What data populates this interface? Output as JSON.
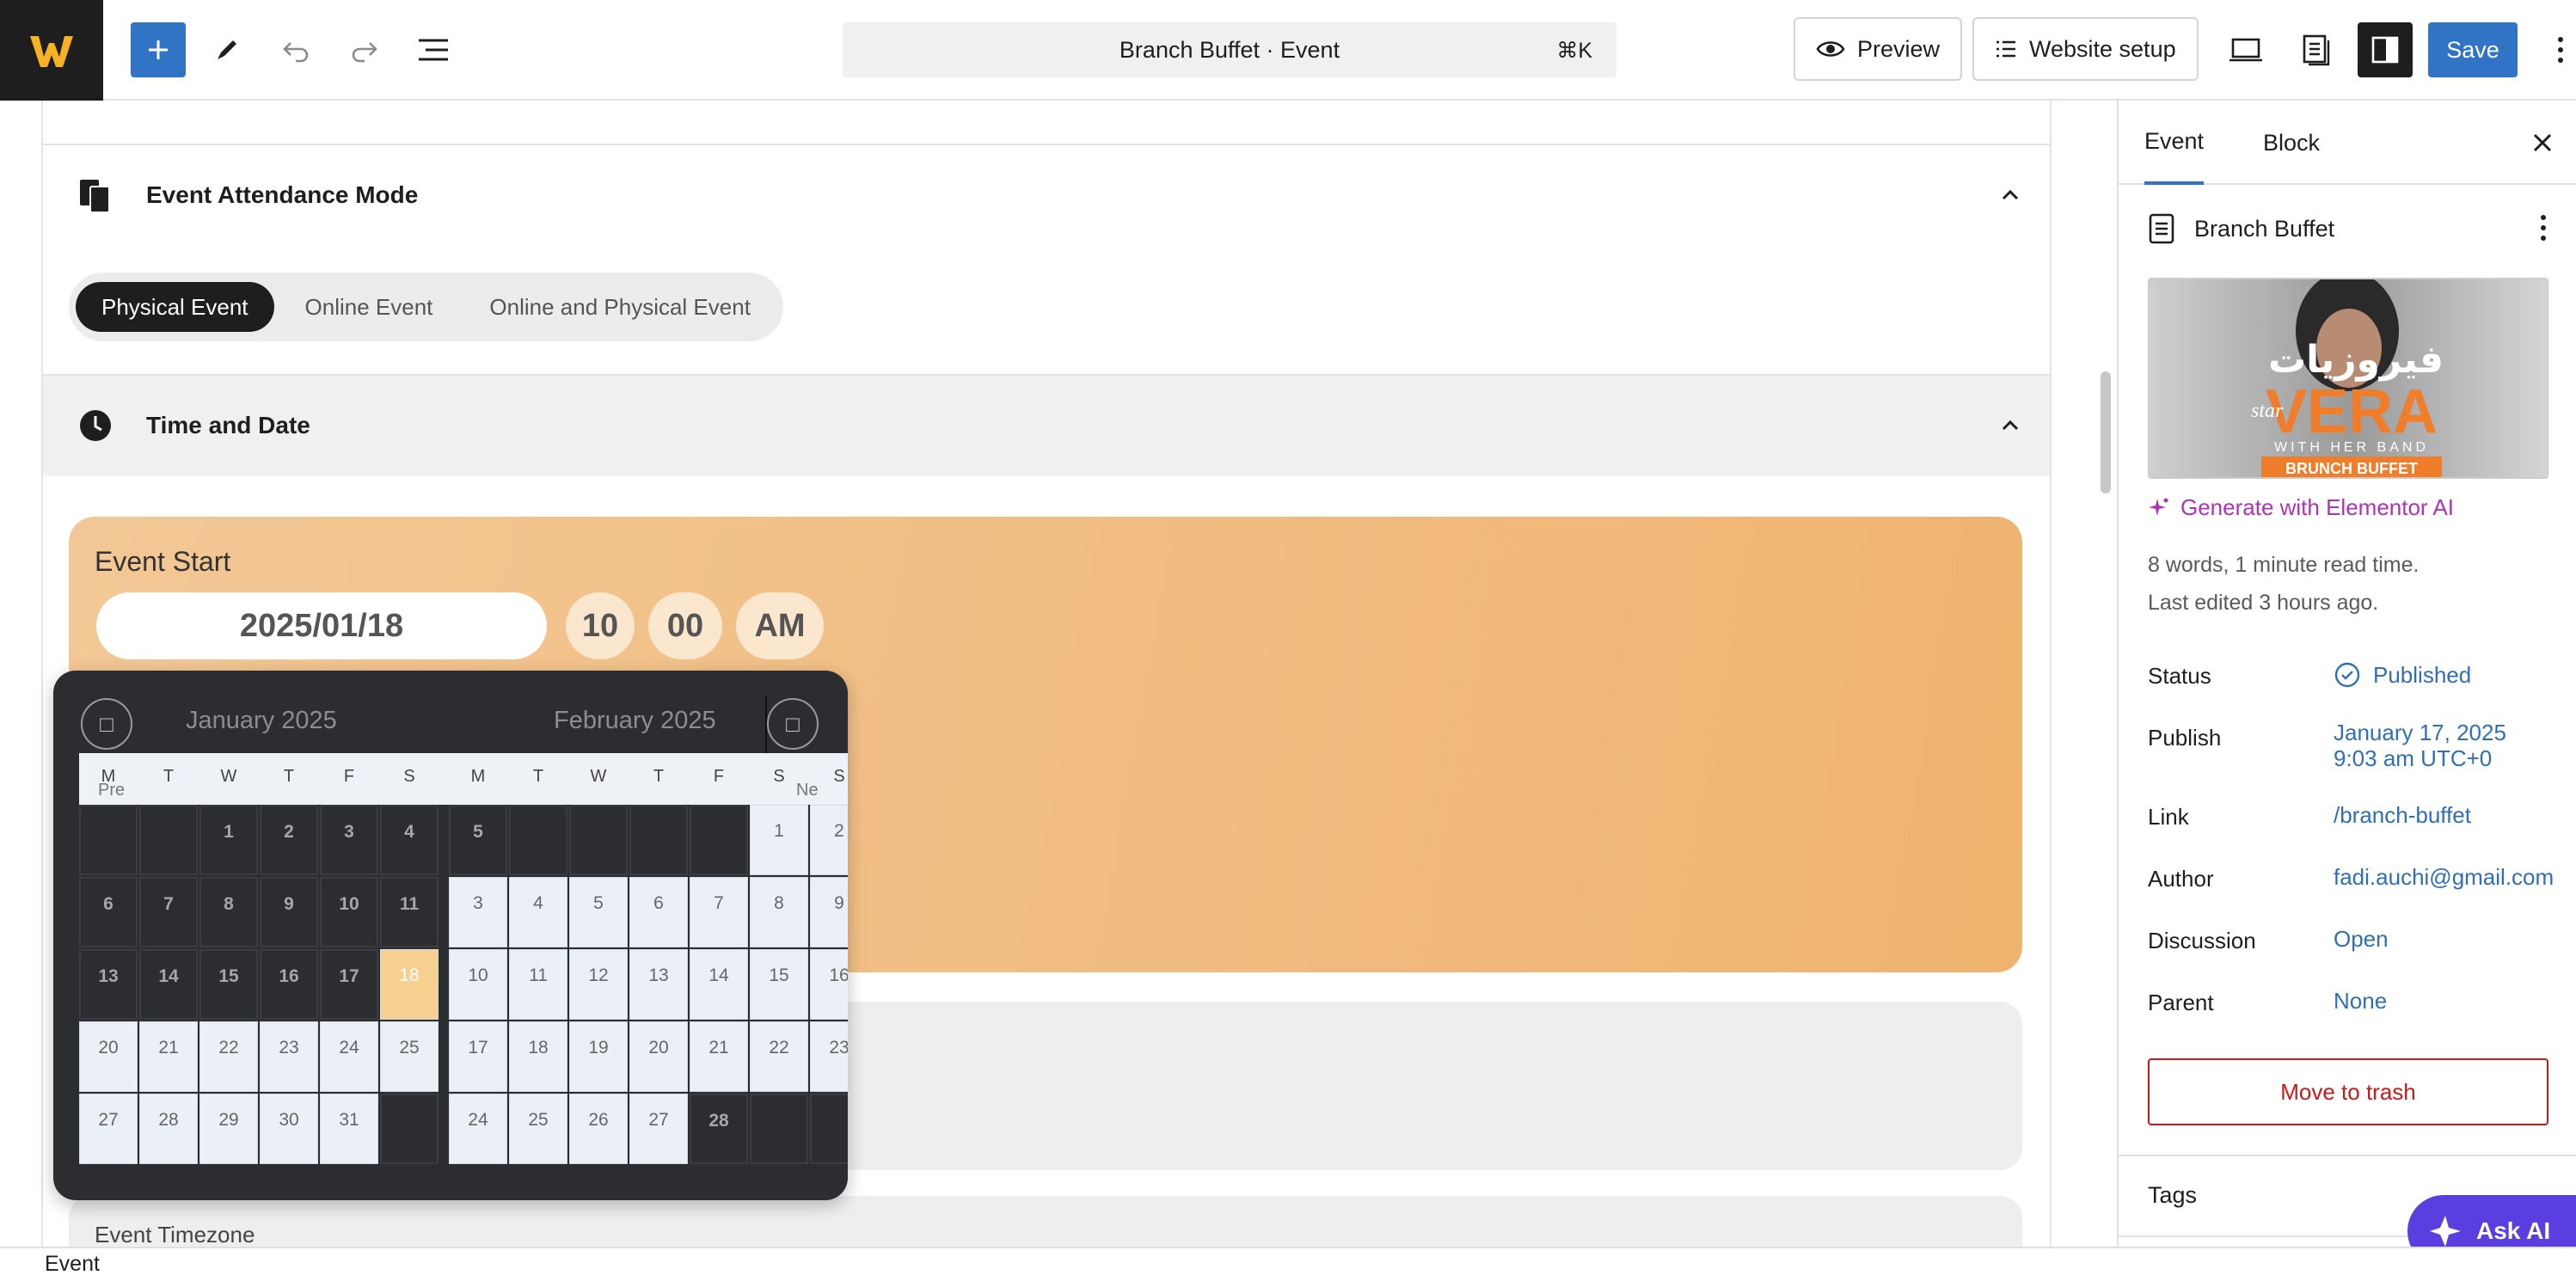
{
  "toolbar": {
    "document_title": "Branch Buffet · Event",
    "shortcut": "⌘K",
    "preview_label": "Preview",
    "website_setup_label": "Website setup",
    "save_label": "Save",
    "icons": [
      "plus-icon",
      "pen-icon",
      "undo-icon",
      "redo-icon",
      "list-view-icon",
      "eye-icon",
      "menu-icon",
      "desktop-icon",
      "page-icon",
      "sidebar-icon",
      "more-vertical-icon"
    ]
  },
  "editor": {
    "attendance": {
      "title": "Event Attendance Mode",
      "options": [
        "Physical Event",
        "Online Event",
        "Online and Physical Event"
      ],
      "selected": "Physical Event"
    },
    "time_date": {
      "title": "Time and Date",
      "event_start_label": "Event Start",
      "date_value": "2025/01/18",
      "hour": "10",
      "minute": "00",
      "ampm": "AM"
    },
    "timezone_label": "Event Timezone"
  },
  "calendar": {
    "left_month": "January 2025",
    "right_month": "February 2025",
    "prev_label": "□",
    "next_label": "□",
    "prev_ghost": "Pre",
    "next_ghost": "Ne",
    "weekdays_left": [
      "M",
      "T",
      "W",
      "T",
      "F",
      "S"
    ],
    "weekdays_right": [
      "M",
      "T",
      "W",
      "T",
      "F",
      "S",
      "S"
    ],
    "selected_day": "18",
    "left_weeks": [
      [
        "",
        "",
        "1",
        "2",
        "3",
        "4"
      ],
      [
        "6",
        "7",
        "8",
        "9",
        "10",
        "11"
      ],
      [
        "13",
        "14",
        "15",
        "16",
        "17",
        "18"
      ],
      [
        "20",
        "21",
        "22",
        "23",
        "24",
        "25"
      ],
      [
        "27",
        "28",
        "29",
        "30",
        "31",
        ""
      ]
    ],
    "left_dark_weeks": [
      [
        true,
        true,
        true,
        true,
        true,
        true
      ],
      [
        true,
        true,
        true,
        true,
        true,
        true
      ],
      [
        true,
        true,
        true,
        true,
        true,
        false
      ],
      [
        false,
        false,
        false,
        false,
        false,
        false
      ],
      [
        false,
        false,
        false,
        false,
        false,
        true
      ]
    ],
    "right_weeks": [
      [
        "5",
        "",
        "",
        "",
        "",
        "1",
        "2"
      ],
      [
        "3",
        "4",
        "5",
        "6",
        "7",
        "8",
        "9"
      ],
      [
        "10",
        "11",
        "12",
        "13",
        "14",
        "15",
        "16"
      ],
      [
        "17",
        "18",
        "19",
        "20",
        "21",
        "22",
        "23"
      ],
      [
        "24",
        "25",
        "26",
        "27",
        "28",
        "",
        ""
      ]
    ],
    "right_dark_weeks": [
      [
        true,
        true,
        true,
        true,
        true,
        false,
        false
      ],
      [
        false,
        false,
        false,
        false,
        false,
        false,
        false
      ],
      [
        false,
        false,
        false,
        false,
        false,
        false,
        false
      ],
      [
        false,
        false,
        false,
        false,
        false,
        false,
        false
      ],
      [
        false,
        false,
        false,
        false,
        true,
        true,
        true
      ]
    ]
  },
  "sidebar": {
    "tabs": [
      "Event",
      "Block"
    ],
    "active_tab": "Event",
    "post_title": "Branch Buffet",
    "image_text": {
      "arabic": "فيروزيات",
      "star": "star",
      "name": "VERA",
      "band": "WITH HER BAND",
      "event": "BRUNCH BUFFET"
    },
    "generate_ai": "Generate with Elementor AI",
    "word_count": "8 words, 1 minute read time.",
    "last_edited": "Last edited 3 hours ago.",
    "rows": [
      {
        "label": "Status",
        "value": "Published"
      },
      {
        "label": "Publish",
        "value": "January 17, 2025",
        "value2": "9:03 am UTC+0"
      },
      {
        "label": "Link",
        "value": "/branch-buffet"
      },
      {
        "label": "Author",
        "value": "fadi.auchi@gmail.com"
      },
      {
        "label": "Discussion",
        "value": "Open"
      },
      {
        "label": "Parent",
        "value": "None"
      }
    ],
    "trash_label": "Move to trash",
    "tags_label": "Tags",
    "ask_ai_label": "Ask AI"
  },
  "footer": {
    "breadcrumb": "Event"
  },
  "colors": {
    "accent": "#3174c6",
    "dark": "#1e1e1e",
    "ai": "#b032b8",
    "danger": "#cc1818",
    "ask_ai": "#5b3ee0"
  }
}
